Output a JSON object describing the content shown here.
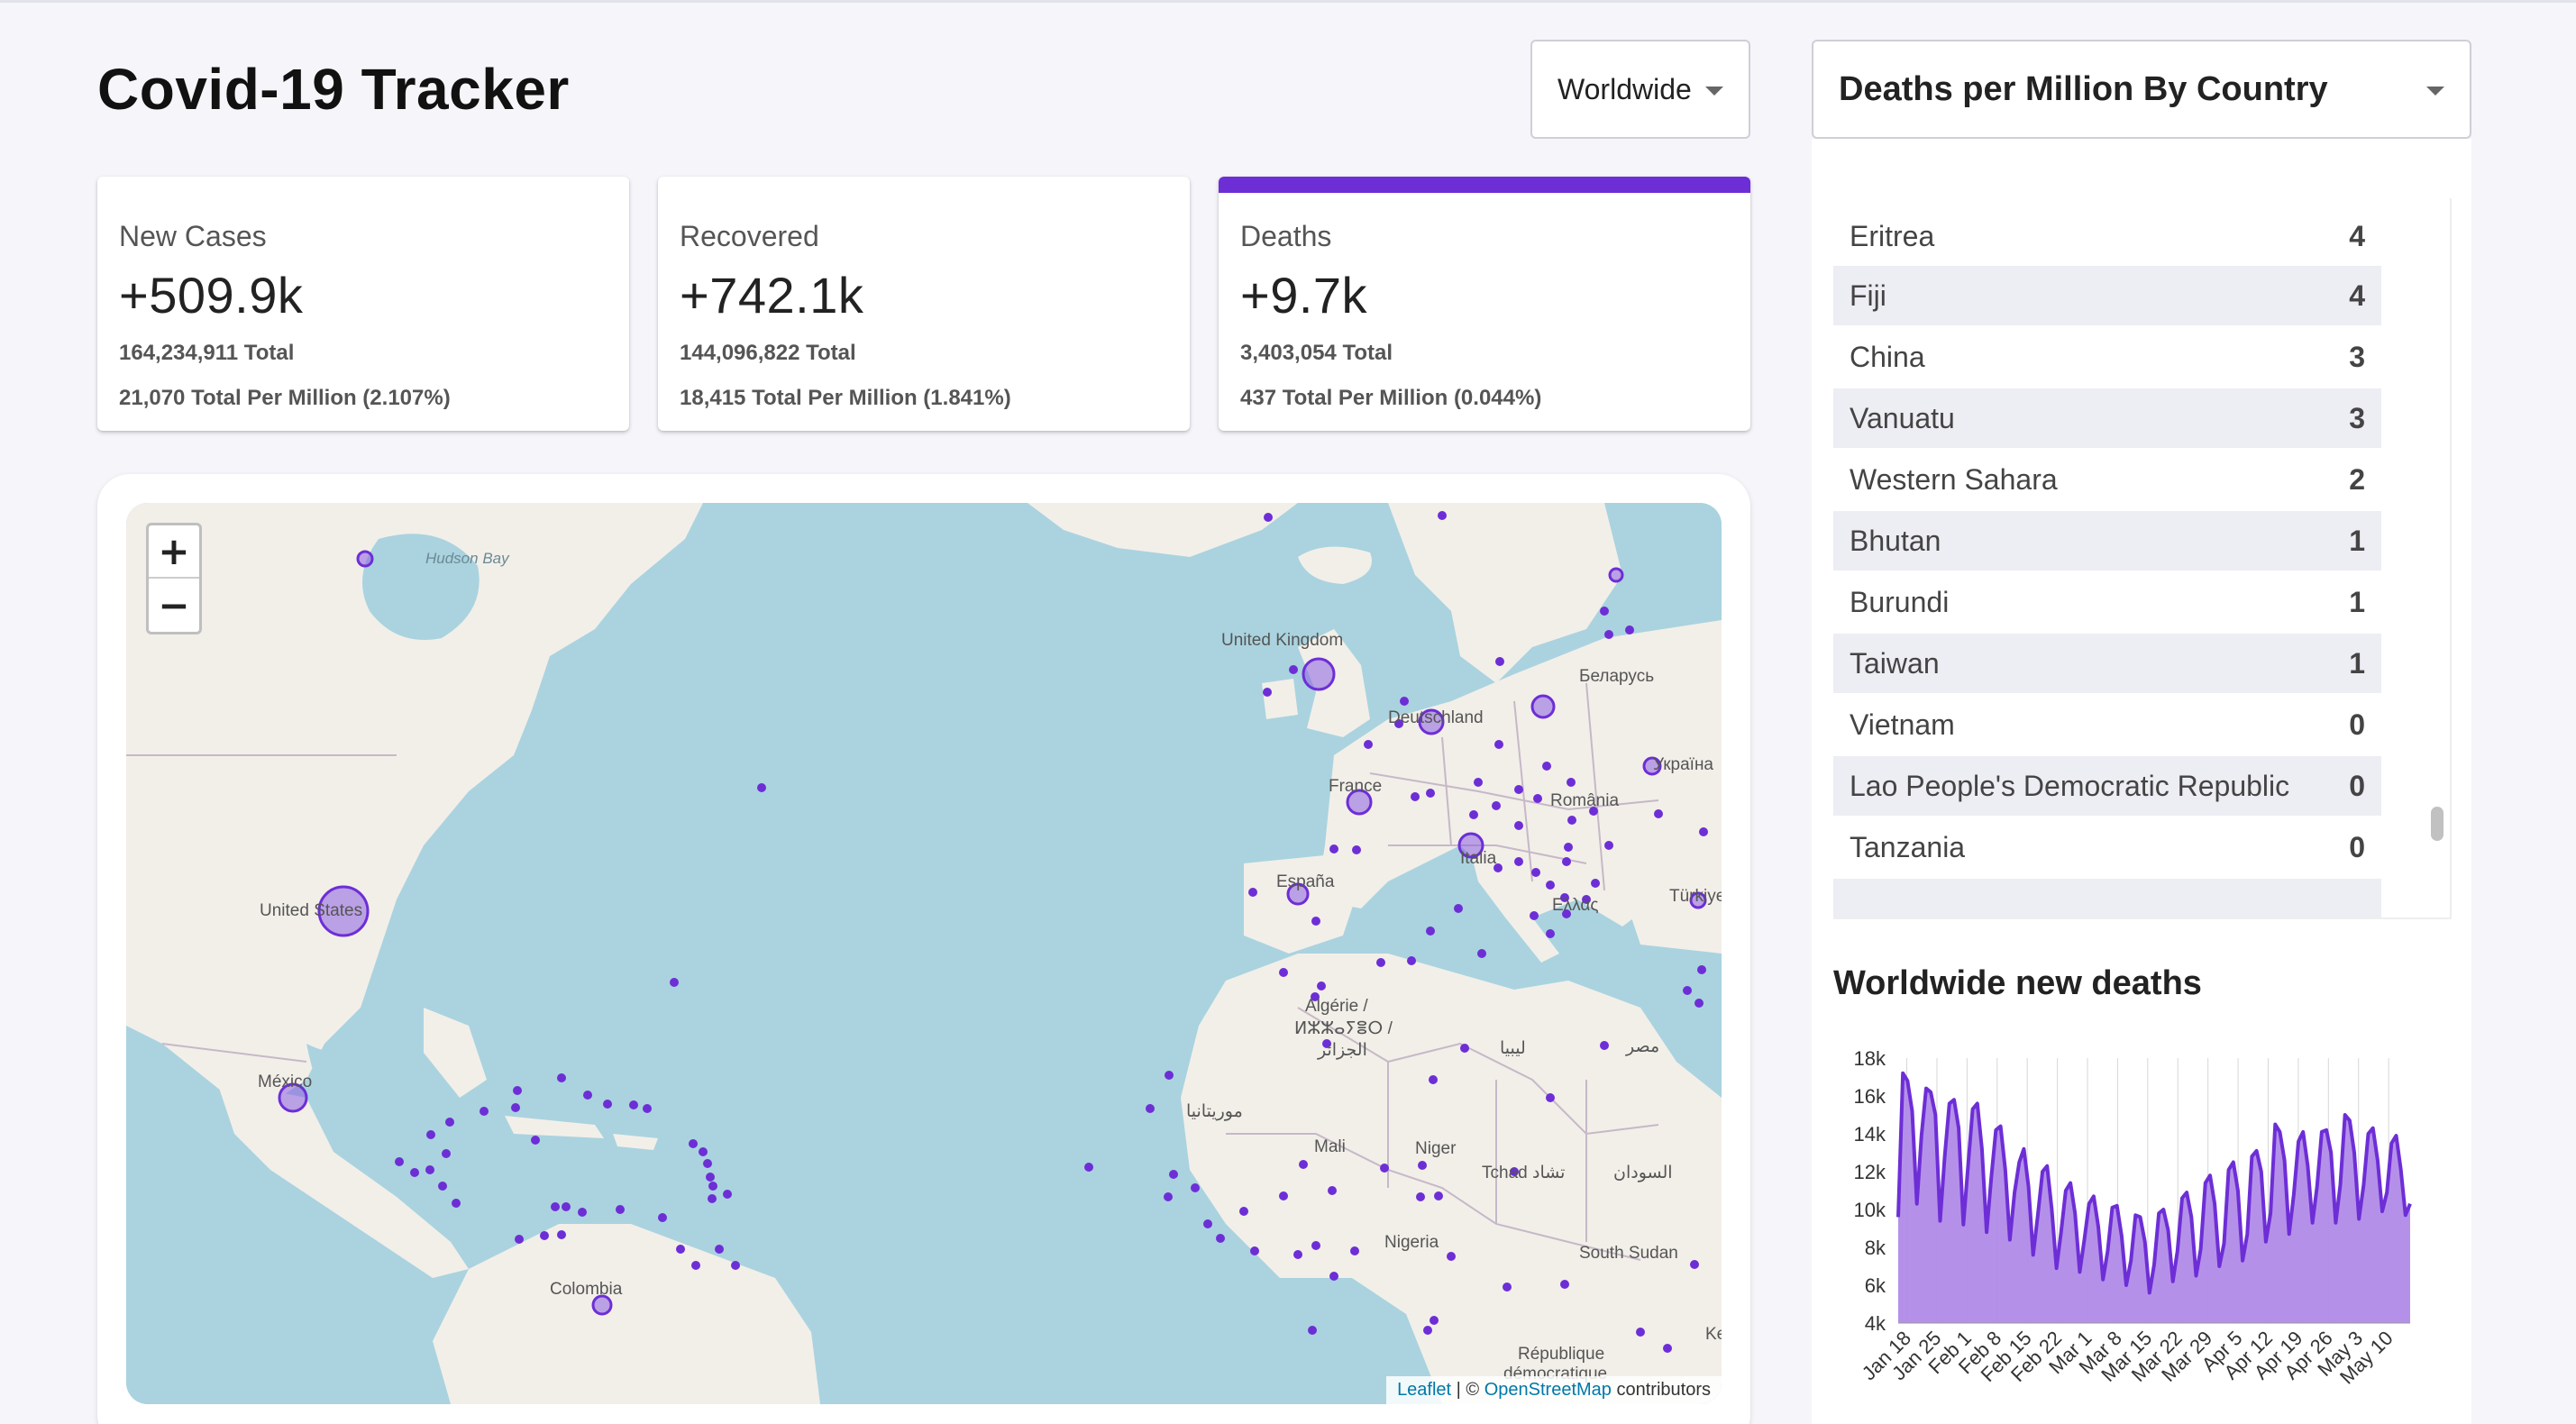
{
  "app": {
    "title": "Covid-19 Tracker"
  },
  "region_select": {
    "selected": "Worldwide"
  },
  "cards": [
    {
      "label": "New Cases",
      "value": "+509.9k",
      "total": "164,234,911 Total",
      "per_million": "21,070 Total Per Million (2.107%)",
      "active": false
    },
    {
      "label": "Recovered",
      "value": "+742.1k",
      "total": "144,096,822 Total",
      "per_million": "18,415 Total Per Million (1.841%)",
      "active": false
    },
    {
      "label": "Deaths",
      "value": "+9.7k",
      "total": "3,403,054 Total",
      "per_million": "437 Total Per Million (0.044%)",
      "active": true
    }
  ],
  "map": {
    "zoom_in": "+",
    "zoom_out": "−",
    "attribution": {
      "leaflet": "Leaflet",
      "separator": " | © ",
      "osm": "OpenStreetMap",
      "suffix": " contributors"
    },
    "labels": {
      "hudson_bay": "Hudson Bay",
      "united_kingdom": "United Kingdom",
      "belarus": "Беларусь",
      "deutschland": "Deutschland",
      "ukraine": "Україна",
      "france": "France",
      "romania": "România",
      "italia": "Italia",
      "espana": "España",
      "ellas": "Ελλάς",
      "turkiye": "Türkiye",
      "united_states": "United States",
      "algerie": "Algérie /",
      "algerie_2": "ⵍⵣⵣⴰⵢⴻⵔ /",
      "algerie_3": "الجزائر",
      "libya": "ليبيا",
      "egypt": "مصر",
      "mexico": "México",
      "mauritania": "موريتانيا",
      "mali": "Mali",
      "niger": "Niger",
      "tchad": "Tchad تشاد",
      "sudan": "السودان",
      "nigeria": "Nigeria",
      "south_sudan": "South Sudan",
      "colombia": "Colombia",
      "republique": "République",
      "centrafrique": "démocratique",
      "kenya": "Ke"
    }
  },
  "stat_select": {
    "selected": "Deaths per Million By Country"
  },
  "country_table": {
    "rows": [
      {
        "country": "Eritrea",
        "value": "4"
      },
      {
        "country": "Fiji",
        "value": "4"
      },
      {
        "country": "China",
        "value": "3"
      },
      {
        "country": "Vanuatu",
        "value": "3"
      },
      {
        "country": "Western Sahara",
        "value": "2"
      },
      {
        "country": "Bhutan",
        "value": "1"
      },
      {
        "country": "Burundi",
        "value": "1"
      },
      {
        "country": "Taiwan",
        "value": "1"
      },
      {
        "country": "Vietnam",
        "value": "0"
      },
      {
        "country": "Lao People's Democratic Republic",
        "value": "0"
      },
      {
        "country": "Tanzania",
        "value": "0"
      }
    ]
  },
  "chart_title": "Worldwide new deaths",
  "colors": {
    "accent": "#6d2ed6",
    "area_fill": "#b18ae8",
    "map_water": "#aad3df",
    "map_land": "#f2efe9"
  },
  "chart_data": {
    "type": "area",
    "title": "Worldwide new deaths",
    "xlabel": "",
    "ylabel": "",
    "ylim": [
      4000,
      18000
    ],
    "y_ticks": [
      "18k",
      "16k",
      "14k",
      "12k",
      "10k",
      "8k",
      "6k",
      "4k"
    ],
    "x_ticks": [
      "Jan 18",
      "Jan 25",
      "Feb 1",
      "Feb 8",
      "Feb 15",
      "Feb 22",
      "Mar 1",
      "Mar 8",
      "Mar 15",
      "Mar 22",
      "Mar 29",
      "Apr 5",
      "Apr 12",
      "Apr 19",
      "Apr 26",
      "May 3",
      "May 10"
    ],
    "x_start": "2021-01-16",
    "x_end": "2021-05-15",
    "values": [
      9600,
      17200,
      16800,
      15200,
      10300,
      13900,
      16400,
      16200,
      15000,
      9400,
      12800,
      15600,
      15800,
      14300,
      9200,
      12300,
      15300,
      15600,
      13200,
      8800,
      11700,
      14200,
      14400,
      12100,
      8400,
      10900,
      12500,
      13200,
      11200,
      7600,
      9700,
      12000,
      12300,
      10000,
      6900,
      8800,
      11000,
      11400,
      9800,
      6700,
      8400,
      10300,
      10700,
      9100,
      6300,
      7800,
      10100,
      10200,
      8600,
      6000,
      7300,
      9700,
      9600,
      8300,
      5600,
      7100,
      9800,
      10000,
      8900,
      6200,
      7800,
      10600,
      10900,
      9600,
      6500,
      7900,
      11400,
      11800,
      10300,
      7000,
      8200,
      12100,
      12500,
      11000,
      7300,
      8700,
      12800,
      13100,
      12000,
      8300,
      9800,
      14500,
      14100,
      12600,
      8700,
      10800,
      13600,
      14100,
      12300,
      9300,
      11200,
      14100,
      14200,
      13000,
      9300,
      11300,
      15000,
      14700,
      13000,
      9500,
      11300,
      14000,
      14300,
      12600,
      9900,
      10900,
      13500,
      13900,
      12100,
      9700,
      10300
    ]
  }
}
